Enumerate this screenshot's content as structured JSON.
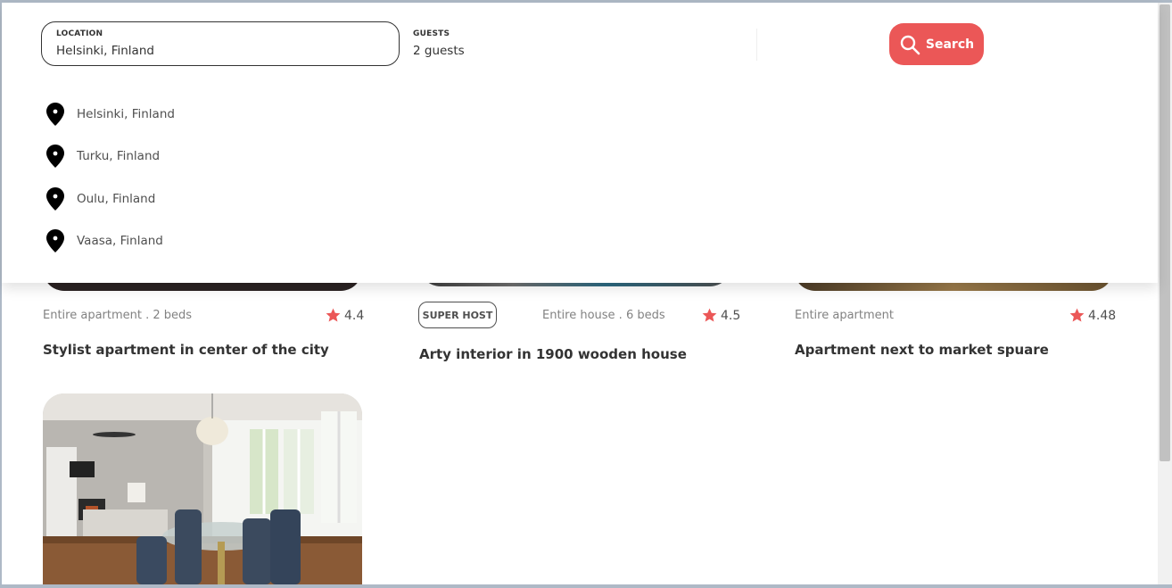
{
  "search": {
    "location_label": "LOCATION",
    "location_value": "Helsinki, Finland",
    "guests_label": "GUESTS",
    "guests_value": "2 guests",
    "button_label": "Search",
    "accent_color": "#eb5757"
  },
  "suggestions": [
    {
      "label": "Helsinki, Finland",
      "icon": "location-pin-icon"
    },
    {
      "label": "Turku, Finland",
      "icon": "location-pin-icon"
    },
    {
      "label": "Oulu, Finland",
      "icon": "location-pin-icon"
    },
    {
      "label": "Vaasa, Finland",
      "icon": "location-pin-icon"
    }
  ],
  "listings": [
    {
      "type": "Entire apartment . 2 beds",
      "rating": "4.4",
      "title": "Stylist apartment in center of the city",
      "superhost": false
    },
    {
      "type": "Entire house . 6 beds",
      "rating": "4.5",
      "title": "Arty interior in 1900 wooden house",
      "superhost": true,
      "badge": "SUPER HOST"
    },
    {
      "type": "Entire apartment",
      "rating": "4.48",
      "title": "Apartment next to market spuare",
      "superhost": false
    }
  ],
  "icons": {
    "rating": "star-icon",
    "search": "search-icon"
  }
}
